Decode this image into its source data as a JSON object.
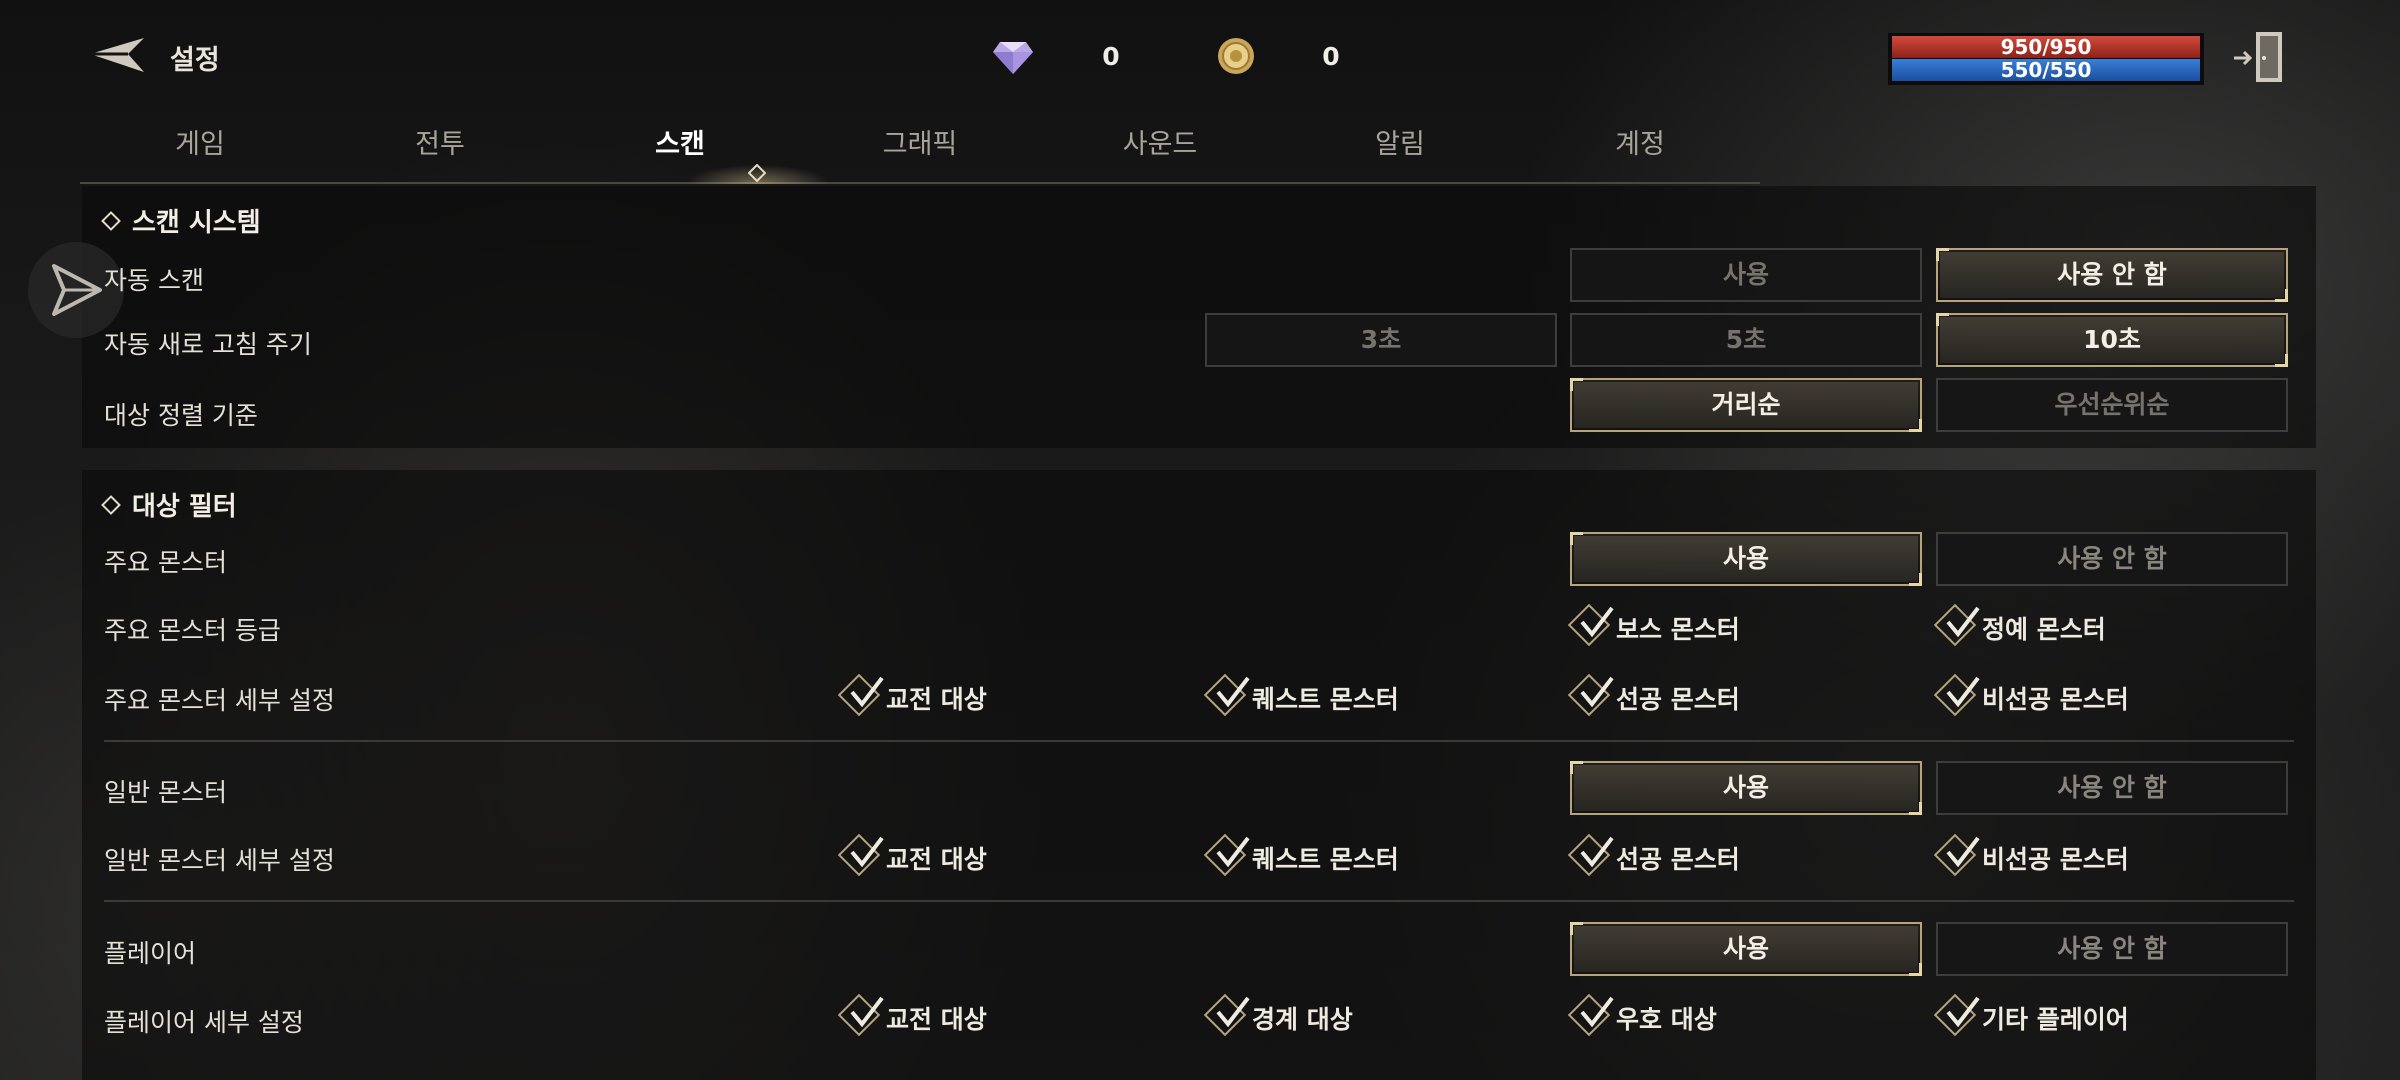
{
  "header": {
    "title": "설정",
    "gem_count": "0",
    "gold_count": "0",
    "hp_text": "950/950",
    "mp_text": "550/550"
  },
  "tabs": [
    {
      "label": "게임"
    },
    {
      "label": "전투"
    },
    {
      "label": "스캔"
    },
    {
      "label": "그래픽"
    },
    {
      "label": "사운드"
    },
    {
      "label": "알림"
    },
    {
      "label": "계정"
    }
  ],
  "active_tab": "스캔",
  "scan_system": {
    "title": "스캔 시스템",
    "auto_scan": {
      "label": "자동 스캔",
      "options": [
        "사용",
        "사용 안 함"
      ],
      "selected": "사용 안 함"
    },
    "refresh": {
      "label": "자동 새로 고침 주기",
      "options": [
        "3초",
        "5초",
        "10초"
      ],
      "selected": "10초"
    },
    "sort": {
      "label": "대상 정렬 기준",
      "options": [
        "거리순",
        "우선순위순"
      ],
      "selected": "거리순"
    }
  },
  "target_filter": {
    "title": "대상 필터",
    "main_monster": {
      "label": "주요 몬스터",
      "options": [
        "사용",
        "사용 안 함"
      ],
      "selected": "사용"
    },
    "main_grade": {
      "label": "주요 몬스터 등급",
      "checks": [
        "보스 몬스터",
        "정예 몬스터"
      ]
    },
    "main_detail": {
      "label": "주요 몬스터 세부 설정",
      "checks": [
        "교전 대상",
        "퀘스트 몬스터",
        "선공 몬스터",
        "비선공 몬스터"
      ]
    },
    "normal_monster": {
      "label": "일반 몬스터",
      "options": [
        "사용",
        "사용 안 함"
      ],
      "selected": "사용"
    },
    "normal_detail": {
      "label": "일반 몬스터 세부 설정",
      "checks": [
        "교전 대상",
        "퀘스트 몬스터",
        "선공 몬스터",
        "비선공 몬스터"
      ]
    },
    "player": {
      "label": "플레이어",
      "options": [
        "사용",
        "사용 안 함"
      ],
      "selected": "사용"
    },
    "player_detail": {
      "label": "플레이어 세부 설정",
      "checks": [
        "교전 대상",
        "경계 대상",
        "우호 대상",
        "기타 플레이어"
      ]
    }
  },
  "colors": {
    "accent": "#b8a47c",
    "hp": "#c0392b",
    "mp": "#2f6fc8"
  }
}
